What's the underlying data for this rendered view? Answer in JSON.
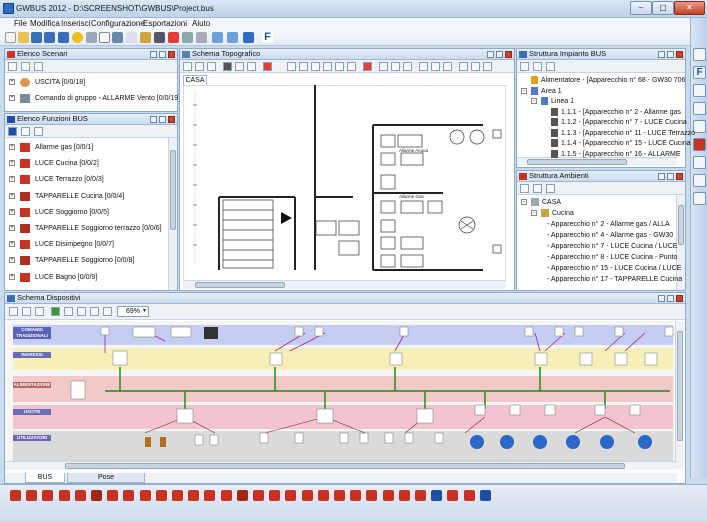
{
  "window": {
    "title": "GWBUS 2012 - D:\\SCREENSHOT\\GWBUS\\Project.bus"
  },
  "menu": [
    "File",
    "Modifica",
    "Inserisci",
    "Configurazione",
    "Esportazioni",
    "Aiuto"
  ],
  "panels": {
    "scenari": {
      "title": "Elenco Scenari",
      "items": [
        "USCITA [0/0/18]",
        "Comando di gruppo - ALLARME Vento [0/0/19]"
      ]
    },
    "funzioni": {
      "title": "Elenco Funzioni BUS",
      "items": [
        "Allarme gas [0/0/1]",
        "LUCE Cucina [0/0/2]",
        "LUCE Terrazzo [0/0/3]",
        "TAPPARELLE Cucina [0/0/4]",
        "LUCE Soggiorno [0/0/5]",
        "TAPPARELLE Soggiorno terrazzo [0/0/6]",
        "LUCE Disimpegno [0/0/7]",
        "TAPPARELLE Soggiorno [0/0/8]",
        "LUCE Bagno [0/0/9]"
      ]
    },
    "topografico": {
      "title": "Schema Topografico",
      "tab": "CASA",
      "labels": [
        "Allarme Acqua",
        "Allarme Gas"
      ]
    },
    "impianto": {
      "title": "Struttura Impianto BUS",
      "items": [
        "Alimentatore - [Apparecchio n° 68 - GW30 706",
        "Area 1",
        "Linea 1",
        "1.1.1 - [Apparecchio n° 2 - Allarme gas",
        "1.1.2 - [Apparecchio n° 7 - LUCE Cucina",
        "1.1.3 - [Apparecchio n° 11 - LUCE Terrazzo",
        "1.1.4 - [Apparecchio n° 15 - LUCE Cucina",
        "1.1.5 - [Apparecchio n° 16 - ALLARME"
      ]
    },
    "ambienti": {
      "title": "Struttura Ambienti",
      "items": [
        "CASA",
        "Cucina",
        "- Apparecchio n° 2 - Allarme gas / ALLA",
        "- Apparecchio n° 4 - Allarme gas - GW30",
        "- Apparecchio n° 7 - LUCE Cucina / LUCE",
        "- Apparecchio n° 8 - LUCE Cucina - Punto",
        "- Apparecchio n° 15 - LUCE Cucina / LUCE",
        "- Apparecchio n° 17 - TAPPARELLE Cucina"
      ]
    },
    "dispositivi": {
      "title": "Schema Dispositivi",
      "zoom": "69%",
      "lanes": [
        "COMANDI TRADIZIONALI",
        "INGRESSI",
        "ALIMENTAZIONE",
        "USCITE",
        "UTILIZZATORI"
      ],
      "tabs": [
        "BUS",
        "Pose"
      ]
    }
  },
  "colors": {
    "accent": "#2d6cc0",
    "bus_green": "#1f8a1f",
    "bus_purple": "#a020a0",
    "lane_blue": "#c6cdf2",
    "lane_yellow": "#f6efb8",
    "lane_pink": "#f3c8c8",
    "lane_rose": "#f2c4d0",
    "lane_gray": "#dadada"
  }
}
